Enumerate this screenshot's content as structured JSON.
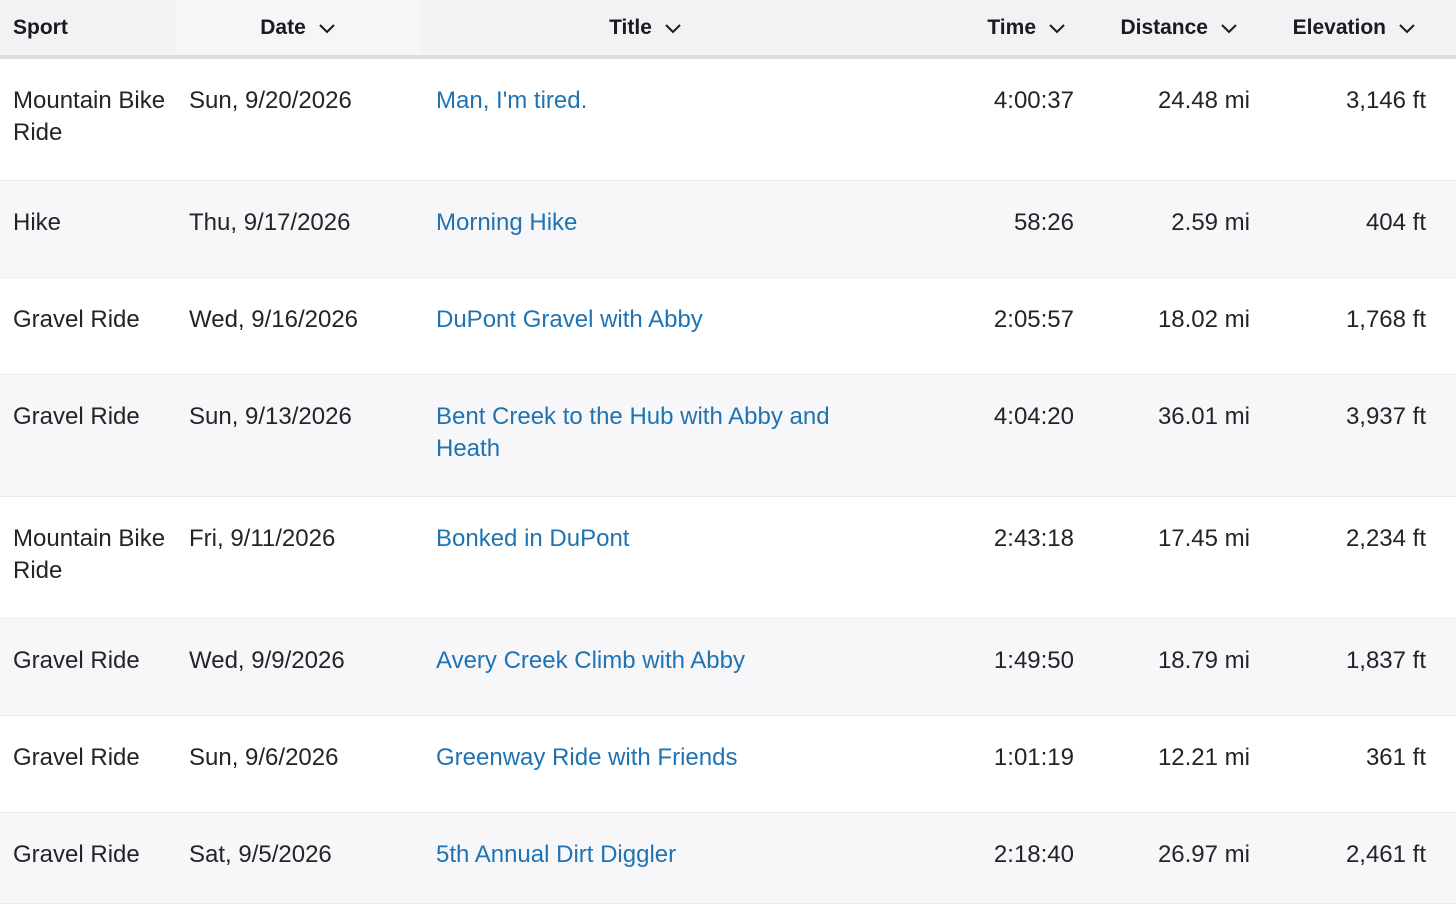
{
  "columns": {
    "sport": "Sport",
    "date": "Date",
    "title": "Title",
    "time": "Time",
    "distance": "Distance",
    "elevation": "Elevation"
  },
  "rows": [
    {
      "sport": "Mountain Bike Ride",
      "date": "Sun, 9/20/2026",
      "title": "Man, I'm tired.",
      "time": "4:00:37",
      "distance": "24.48 mi",
      "elevation": "3,146 ft"
    },
    {
      "sport": "Hike",
      "date": "Thu, 9/17/2026",
      "title": "Morning Hike",
      "time": "58:26",
      "distance": "2.59 mi",
      "elevation": "404 ft"
    },
    {
      "sport": "Gravel Ride",
      "date": "Wed, 9/16/2026",
      "title": "DuPont Gravel with Abby",
      "time": "2:05:57",
      "distance": "18.02 mi",
      "elevation": "1,768 ft"
    },
    {
      "sport": "Gravel Ride",
      "date": "Sun, 9/13/2026",
      "title": "Bent Creek to the Hub with Abby and Heath",
      "time": "4:04:20",
      "distance": "36.01 mi",
      "elevation": "3,937 ft"
    },
    {
      "sport": "Mountain Bike Ride",
      "date": "Fri, 9/11/2026",
      "title": "Bonked in DuPont",
      "time": "2:43:18",
      "distance": "17.45 mi",
      "elevation": "2,234 ft"
    },
    {
      "sport": "Gravel Ride",
      "date": "Wed, 9/9/2026",
      "title": "Avery Creek Climb with Abby",
      "time": "1:49:50",
      "distance": "18.79 mi",
      "elevation": "1,837 ft"
    },
    {
      "sport": "Gravel Ride",
      "date": "Sun, 9/6/2026",
      "title": "Greenway Ride with Friends",
      "time": "1:01:19",
      "distance": "12.21 mi",
      "elevation": "361 ft"
    },
    {
      "sport": "Gravel Ride",
      "date": "Sat, 9/5/2026",
      "title": "5th Annual Dirt Diggler",
      "time": "2:18:40",
      "distance": "26.97 mi",
      "elevation": "2,461 ft"
    }
  ],
  "colors": {
    "link": "#1f73b2",
    "header_bg": "#f2f2f5",
    "alt_row_bg": "#f7f7fa",
    "text": "#242428"
  },
  "icons": {
    "sort": "chevron-down-icon"
  }
}
